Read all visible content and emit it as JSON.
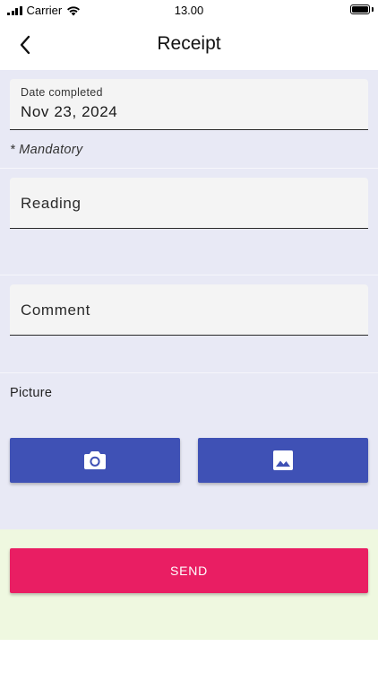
{
  "status_bar": {
    "carrier": "Carrier",
    "time": "13.00",
    "signal_icon": "cellular-signal-icon",
    "wifi_icon": "wifi-icon",
    "battery_icon": "battery-icon"
  },
  "app_bar": {
    "title": "Receipt",
    "back_icon": "chevron-left-icon"
  },
  "form": {
    "date_field": {
      "label": "Date completed",
      "value": "Nov 23, 2024"
    },
    "mandatory_note": "* Mandatory",
    "reading_field": {
      "placeholder": "Reading",
      "value": ""
    },
    "comment_field": {
      "placeholder": "Comment",
      "value": ""
    },
    "picture": {
      "label": "Picture",
      "camera_icon": "camera-icon",
      "gallery_icon": "image-icon"
    }
  },
  "actions": {
    "send_label": "SEND"
  },
  "colors": {
    "form_background": "#e8e9f5",
    "field_background": "#f4f4f4",
    "primary_button": "#3f51b5",
    "send_button": "#e91e63",
    "send_area_background": "#eff8e0"
  }
}
